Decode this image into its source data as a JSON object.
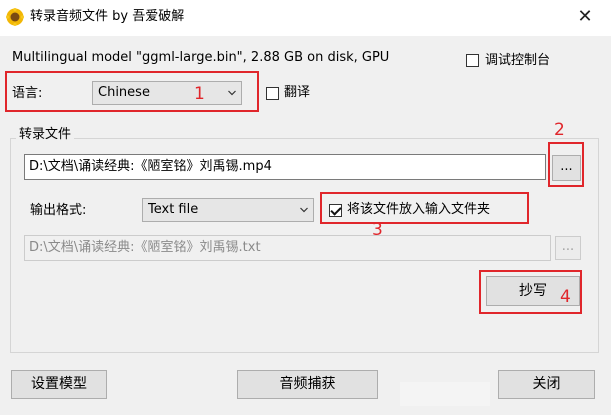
{
  "window": {
    "title": "转录音频文件 by 吾爱破解",
    "close_glyph": "✕"
  },
  "model_info": "Multilingual model \"ggml-large.bin\", 2.88 GB on disk, GPU",
  "debug_console": {
    "label": "调试控制台",
    "checked": false
  },
  "language": {
    "label": "语言:",
    "selected": "Chinese"
  },
  "translate": {
    "label": "翻译",
    "checked": false
  },
  "transcribe_group": {
    "title": "转录文件",
    "input_path": "D:\\文档\\诵读经典:《陋室铭》刘禹锡.mp4",
    "browse_label": "...",
    "output_format": {
      "label": "输出格式:",
      "selected": "Text file"
    },
    "place_in_input_folder": {
      "label": "将该文件放入输入文件夹",
      "checked": true
    },
    "output_path": "D:\\文档\\诵读经典:《陋室铭》刘禹锡.txt",
    "browse_output_label": "...",
    "transcribe_button": "抄写"
  },
  "footer": {
    "setup_model": "设置模型",
    "audio_capture": "音频捕获",
    "close": "关闭"
  },
  "annotations": [
    "1",
    "2",
    "3",
    "4"
  ],
  "colors": {
    "annotation": "#e0262b",
    "window_bg": "#f0f0f0",
    "titlebar_bg": "#ffffff"
  }
}
